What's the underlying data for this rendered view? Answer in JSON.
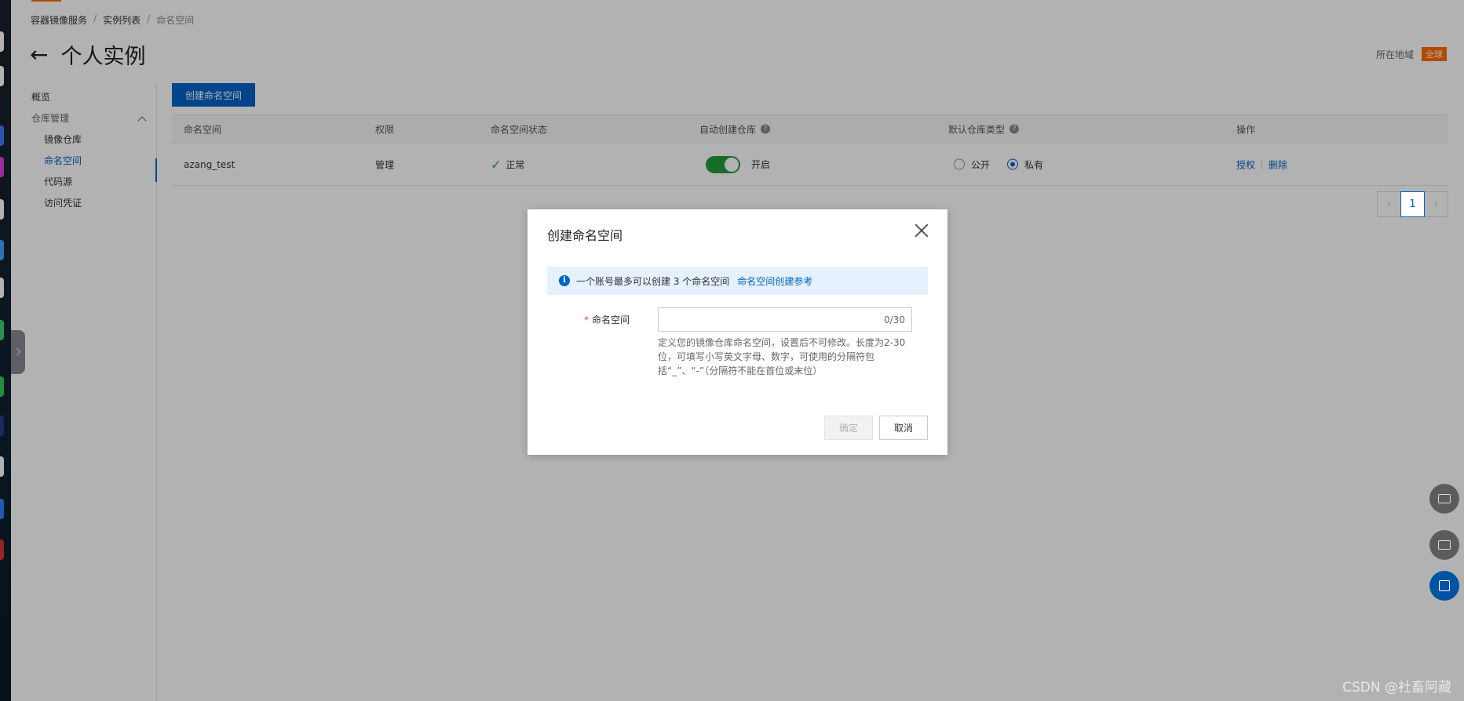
{
  "breadcrumb": {
    "items": [
      "容器镜像服务",
      "实例列表",
      "命名空间"
    ],
    "separator": "/"
  },
  "page": {
    "title": "个人实例",
    "region_label": "所在地域",
    "region_value": "全球"
  },
  "sidebar": {
    "overview": "概览",
    "group_label": "仓库管理",
    "items": [
      {
        "label": "镜像仓库"
      },
      {
        "label": "命名空间"
      },
      {
        "label": "代码源"
      },
      {
        "label": "访问凭证"
      }
    ]
  },
  "toolbar": {
    "create_label": "创建命名空间"
  },
  "table": {
    "columns": [
      "命名空间",
      "权限",
      "命名空间状态",
      "自动创建仓库",
      "默认仓库类型",
      "操作"
    ],
    "rows": [
      {
        "name": "azang_test",
        "permission": "管理",
        "status": "正常",
        "auto_create": "开启",
        "repo_type_public": "公开",
        "repo_type_private": "私有",
        "action_auth": "授权",
        "action_delete": "删除"
      }
    ]
  },
  "pagination": {
    "prev": "‹",
    "current": "1",
    "next": "›"
  },
  "modal": {
    "title": "创建命名空间",
    "notice_text": "一个账号最多可以创建 3 个命名空间",
    "notice_link": "命名空间创建参考",
    "field_label": "命名空间",
    "required_mark": "*",
    "input_value": "",
    "counter": "0/30",
    "hint": "定义您的镜像仓库命名空间，设置后不可修改。长度为2-30位，可填写小写英文字母、数字，可使用的分隔符包括“_”、“-”（分隔符不能在首位或末位）",
    "ok_label": "确定",
    "cancel_label": "取消"
  },
  "watermark": "CSDN @社畜阿藏",
  "colors": {
    "brand": "#0064c8",
    "accent": "#ff6a00",
    "success": "#1f9d3c"
  },
  "icons": [
    "back-arrow-icon",
    "chevron-up-icon",
    "help-icon",
    "check-icon",
    "info-icon",
    "close-icon",
    "feedback-icon",
    "chat-icon",
    "apps-icon"
  ]
}
